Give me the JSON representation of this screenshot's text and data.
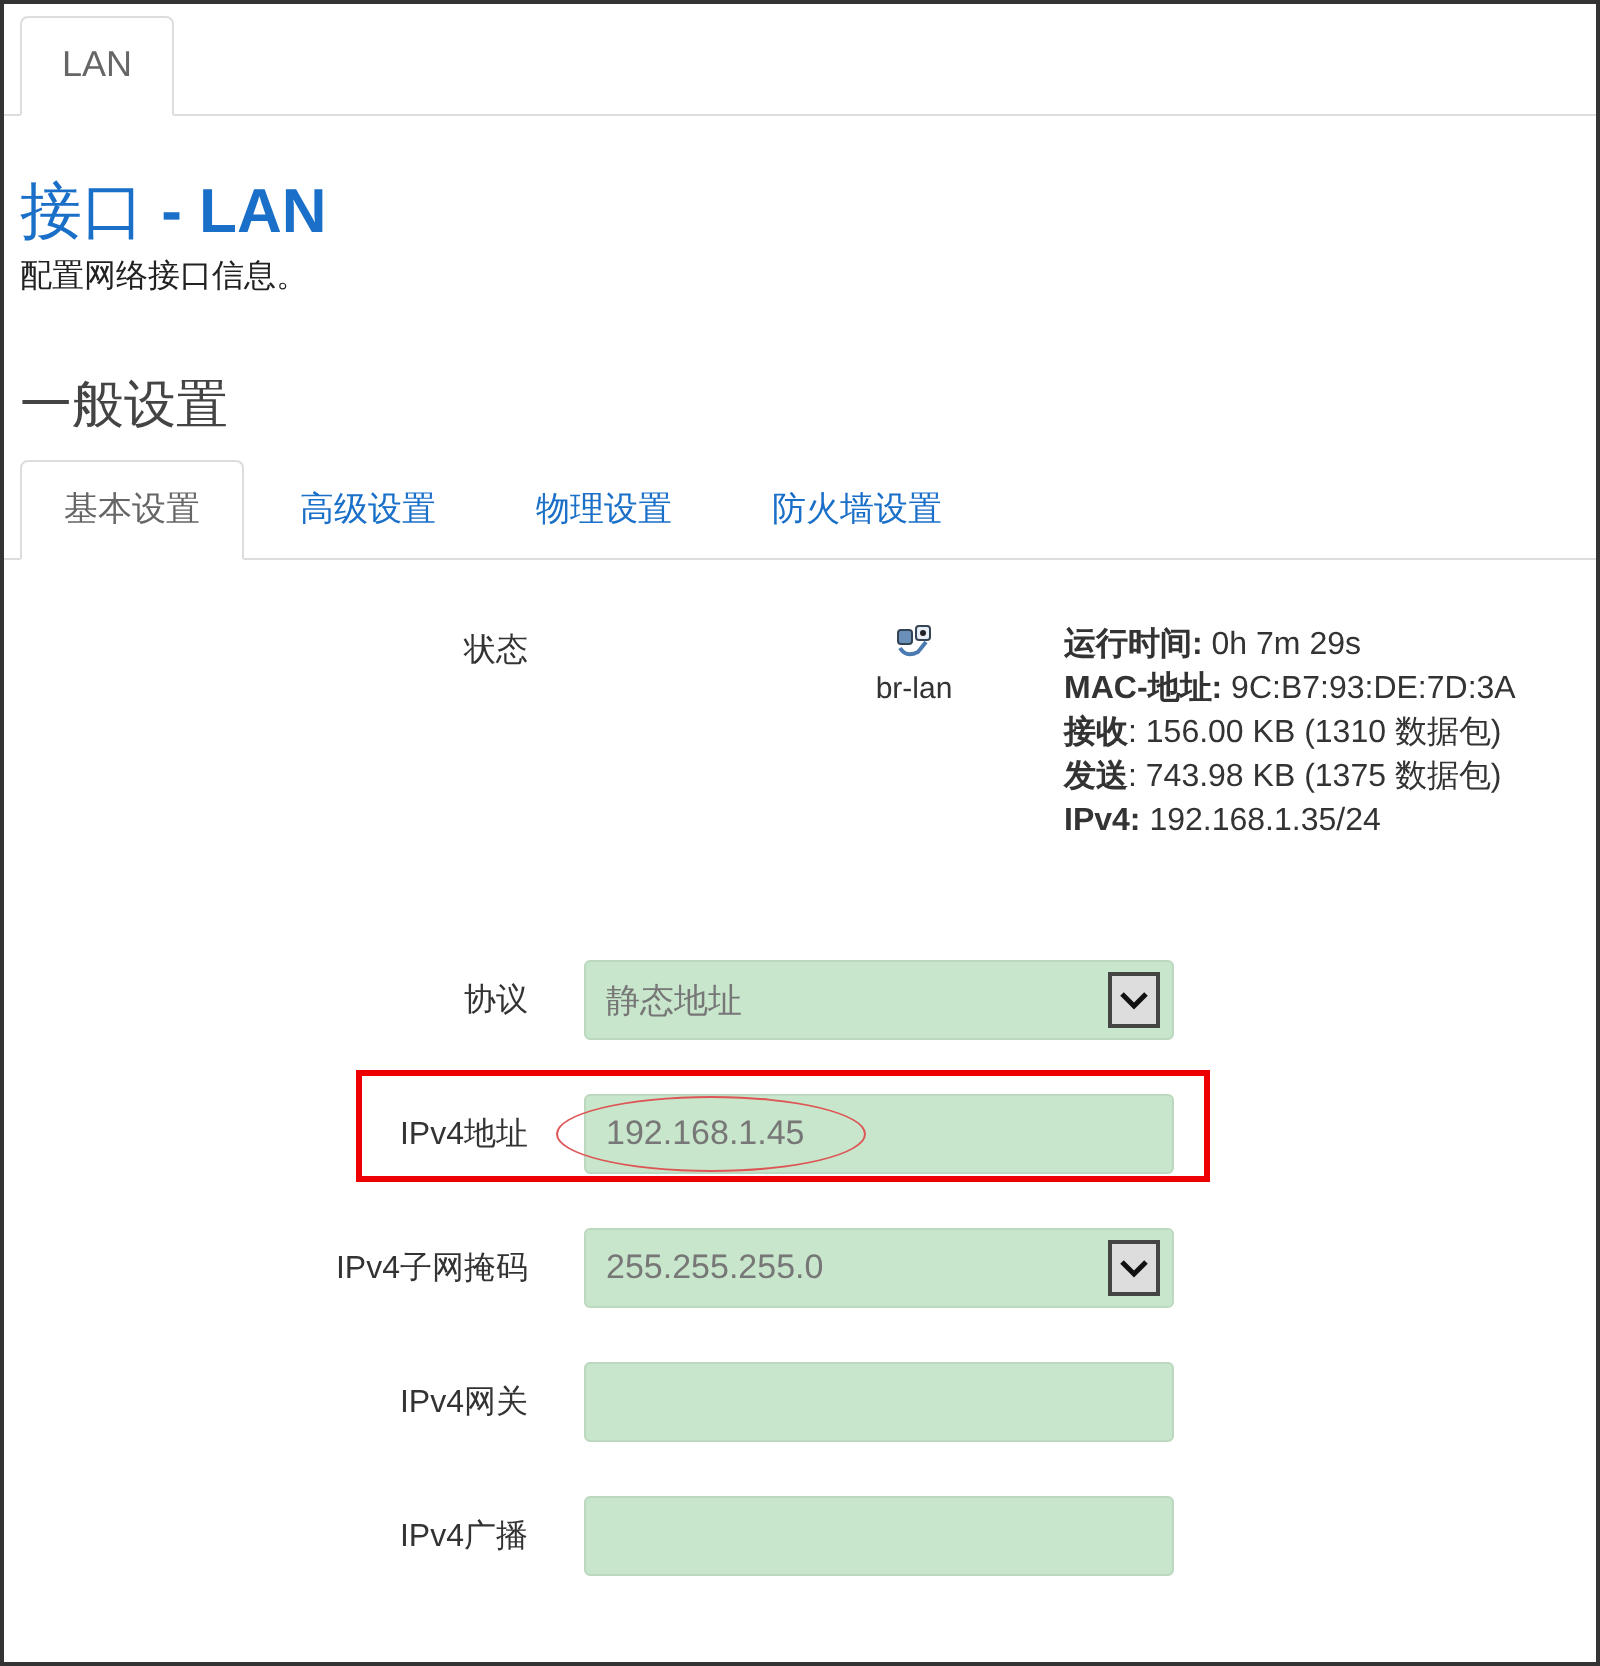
{
  "top_tabs": [
    {
      "label": "LAN",
      "selected": true
    }
  ],
  "page_title": "接口 **- LAN**",
  "description": "配置网络接口信息。",
  "section_title": "一般设置",
  "section_tabs": [
    {
      "label": "基本设置",
      "selected": true
    },
    {
      "label": "高级设置",
      "selected": false
    },
    {
      "label": "物理设置",
      "selected": false
    },
    {
      "label": "防火墙设置",
      "selected": false
    }
  ],
  "status": {
    "label": "状态",
    "device": "br-lan",
    "lines": [
      "**运行时间:** 0h 7m 29s",
      "**MAC-地址:** 9C:B7:93:DE:7D:3A",
      "**接收**: 156.00 KB (1310 数据包)",
      "**发送**: 743.98 KB (1375 数据包)",
      "**IPv4:** 192.168.1.35/24"
    ]
  },
  "fields": [
    {
      "label": "协议",
      "kind": "select",
      "value": "静态地址"
    },
    {
      "label": "IPv4地址",
      "kind": "input",
      "value": "192.168.1.45",
      "highlighted": true,
      "circled": true
    },
    {
      "label": "IPv4子网掩码",
      "kind": "select",
      "value": "255.255.255.0"
    },
    {
      "label": "IPv4网关",
      "kind": "input"
    },
    {
      "label": "IPv4广播",
      "kind": "input"
    }
  ]
}
